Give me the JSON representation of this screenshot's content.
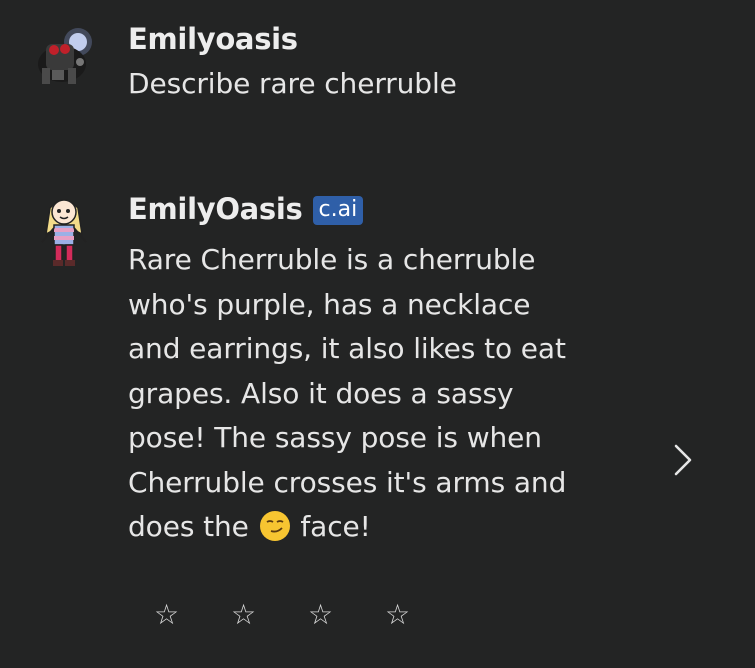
{
  "user_message": {
    "author": "Emilyoasis",
    "text": "Describe rare cherruble"
  },
  "bot_message": {
    "author": "EmilyOasis",
    "badge": "c.ai",
    "lines": [
      "Rare Cherruble is a cherruble",
      "who's purple, has a necklace",
      "and earrings, it also likes to eat",
      "grapes. Also it does a sassy",
      "pose! The sassy pose is when",
      "Cherruble crosses it's arms and"
    ],
    "last_line_before_emoji": "does the",
    "last_line_after_emoji": "face!",
    "emoji": "smirking-face"
  },
  "rating": {
    "stars": [
      "☆",
      "☆",
      "☆",
      "☆"
    ]
  },
  "navigation": {
    "next_icon": "chevron-right-icon"
  }
}
